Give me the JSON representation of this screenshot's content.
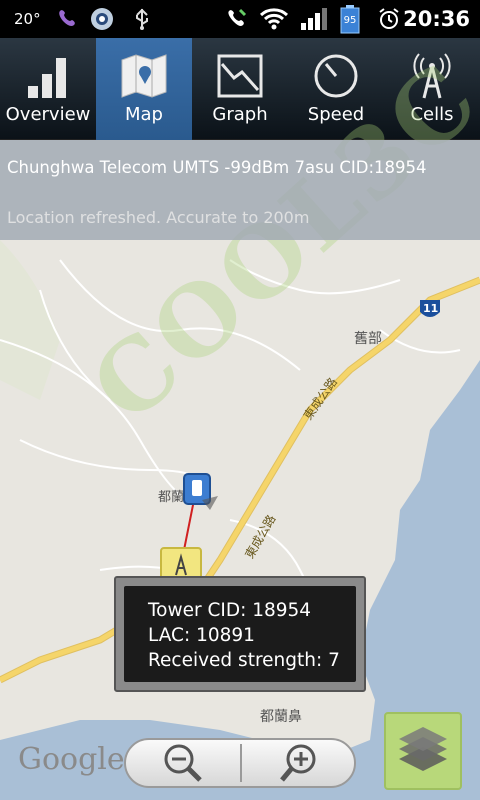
{
  "status_bar": {
    "temperature": "20°",
    "battery": "95",
    "clock": "20:36"
  },
  "tabs": [
    {
      "label": "Overview",
      "icon": "bars-icon",
      "active": false
    },
    {
      "label": "Map",
      "icon": "map-icon",
      "active": true
    },
    {
      "label": "Graph",
      "icon": "graph-icon",
      "active": false
    },
    {
      "label": "Speed",
      "icon": "speedometer-icon",
      "active": false
    },
    {
      "label": "Cells",
      "icon": "antenna-icon",
      "active": false
    }
  ],
  "info": {
    "network": "Chunghwa Telecom UMTS -99dBm 7asu  CID:18954",
    "location_status": "Location refreshed. Accurate to 200m"
  },
  "watermark": "COOL3C",
  "map_labels": {
    "road_11": "11",
    "place1": "舊部",
    "place2": "都蘭",
    "place3": "都蘭鼻",
    "road1": "東成公路",
    "road2": "東成公路"
  },
  "popup": {
    "tower_cid": "Tower CID: 18954",
    "lac": "LAC: 10891",
    "strength": "Received strength: 7"
  },
  "google_logo": "Google",
  "colors": {
    "sea": "#a9bfd6",
    "land": "#e8e6e0",
    "road_major": "#f5d56a",
    "tab_active": "#2f63a0",
    "layers_button": "#b8d87a"
  }
}
